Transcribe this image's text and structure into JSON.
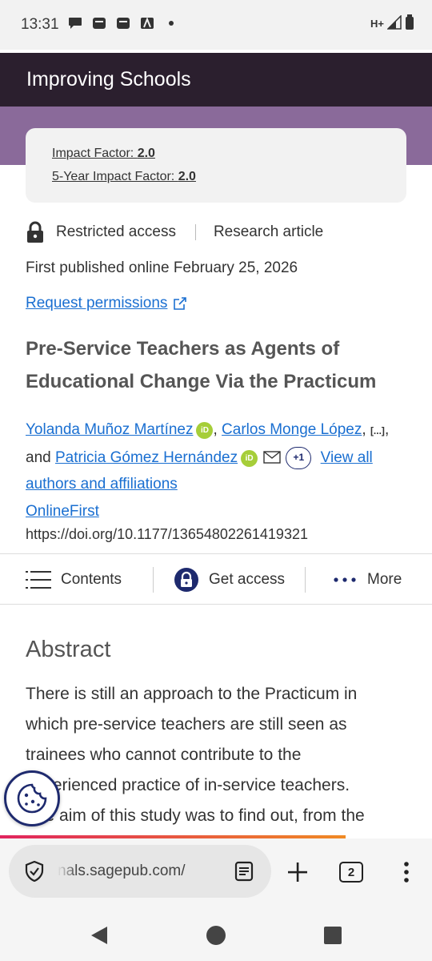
{
  "status_bar": {
    "time": "13:31",
    "network": "H+"
  },
  "journal": {
    "title": "Improving Schools"
  },
  "impact": {
    "impact_factor_label": "Impact Factor: ",
    "impact_factor_value": "2.0",
    "five_year_label": "5-Year Impact Factor: ",
    "five_year_value": "2.0"
  },
  "article_meta": {
    "access": "Restricted access",
    "type": "Research article",
    "published": "First published online February 25, 2026",
    "request_permissions": "Request permissions"
  },
  "article": {
    "title": "Pre-Service Teachers as Agents of Educational Change Via the Practicum",
    "authors": [
      "Yolanda Muñoz Martínez",
      "Carlos Monge López",
      "Patricia Gómez Hernández"
    ],
    "ellipsis": "[...]",
    "and_text": "and",
    "more_authors": "+1",
    "view_all": "View all authors and affiliations",
    "online_first": "OnlineFirst",
    "doi": "https://doi.org/10.1177/13654802261419321"
  },
  "actions": {
    "contents": "Contents",
    "get_access": "Get access",
    "more": "More"
  },
  "abstract": {
    "heading": "Abstract",
    "lines": [
      "There is still an approach to the Practicum in",
      "which pre-service teachers are still seen as",
      "trainees who cannot contribute to the",
      "experienced practice of in-service teachers.",
      "The aim of this study was to find out, from the"
    ]
  },
  "browser": {
    "url": "nals.sagepub.com/",
    "tab_count": "2"
  },
  "colors": {
    "journal_bar": "#2b1f2e",
    "purple": "#8a6a9a",
    "link": "#1a6fd1",
    "navy": "#1e2a6e",
    "orcid": "#a6ce39"
  }
}
